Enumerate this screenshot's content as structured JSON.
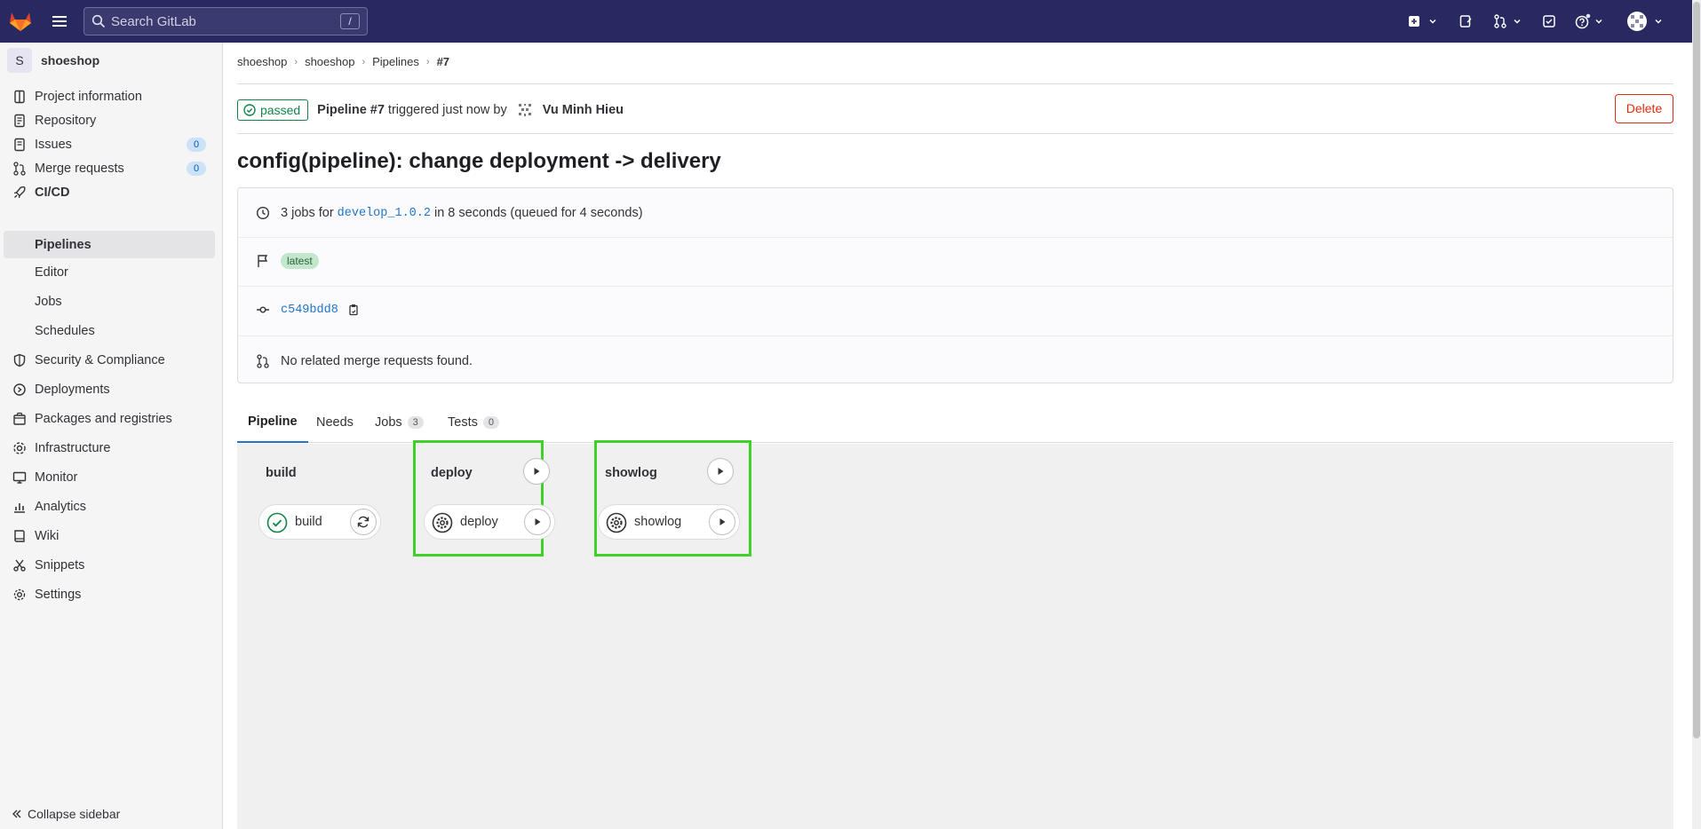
{
  "topbar": {
    "search_placeholder": "Search GitLab",
    "search_shortcut": "/"
  },
  "sidebar": {
    "project_initial": "S",
    "project_name": "shoeshop",
    "items": [
      {
        "label": "Project information"
      },
      {
        "label": "Repository"
      },
      {
        "label": "Issues",
        "count": "0"
      },
      {
        "label": "Merge requests",
        "count": "0"
      },
      {
        "label": "CI/CD"
      },
      {
        "label": "Pipelines"
      },
      {
        "label": "Editor"
      },
      {
        "label": "Jobs"
      },
      {
        "label": "Schedules"
      },
      {
        "label": "Security & Compliance"
      },
      {
        "label": "Deployments"
      },
      {
        "label": "Packages and registries"
      },
      {
        "label": "Infrastructure"
      },
      {
        "label": "Monitor"
      },
      {
        "label": "Analytics"
      },
      {
        "label": "Wiki"
      },
      {
        "label": "Snippets"
      },
      {
        "label": "Settings"
      }
    ],
    "collapse_label": "Collapse sidebar"
  },
  "breadcrumb": [
    "shoeshop",
    "shoeshop",
    "Pipelines",
    "#7"
  ],
  "pipeline": {
    "status": "passed",
    "name": "Pipeline #7",
    "triggered_text": "triggered just now by",
    "user": "Vu Minh Hieu",
    "delete_label": "Delete",
    "title": "config(pipeline): change deployment -> delivery",
    "jobs_prefix": "3 jobs for",
    "branch": "develop_1.0.2",
    "jobs_suffix": "in 8 seconds (queued for 4 seconds)",
    "tag": "latest",
    "commit": "c549bdd8",
    "mr_text": "No related merge requests found."
  },
  "tabs": [
    {
      "label": "Pipeline"
    },
    {
      "label": "Needs"
    },
    {
      "label": "Jobs",
      "count": "3"
    },
    {
      "label": "Tests",
      "count": "0"
    }
  ],
  "stages": [
    {
      "name": "build",
      "job": "build",
      "job_status": "success"
    },
    {
      "name": "deploy",
      "job": "deploy",
      "job_status": "manual"
    },
    {
      "name": "showlog",
      "job": "showlog",
      "job_status": "manual"
    }
  ],
  "colors": {
    "topbar": "#292961",
    "success": "#108548",
    "danger": "#dd2b0e",
    "highlight": "#3fd02a",
    "link": "#1f75cb"
  }
}
